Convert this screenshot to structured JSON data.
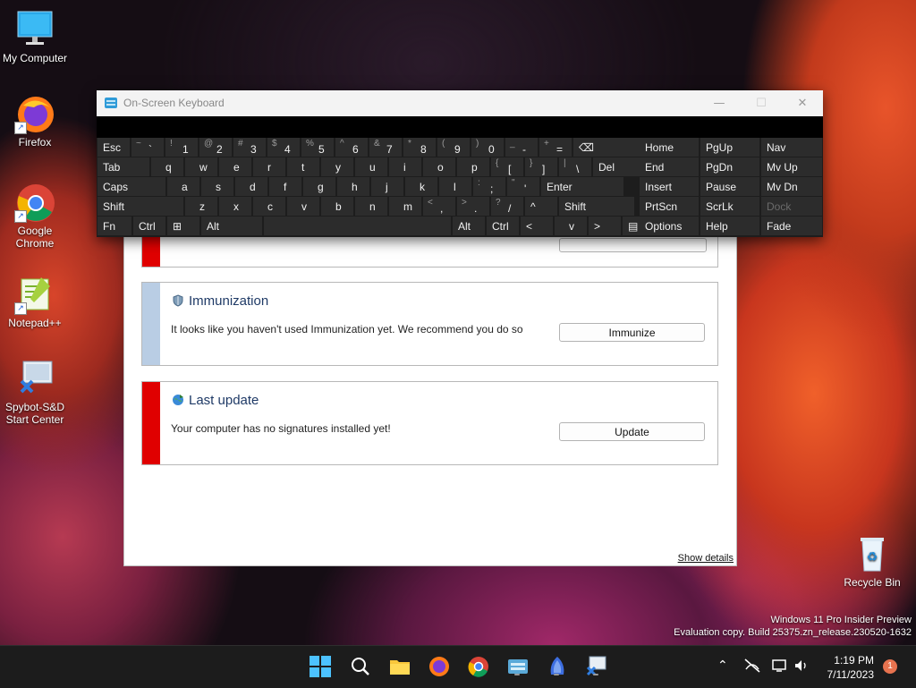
{
  "desktop": {
    "icons": [
      {
        "label": "My Computer"
      },
      {
        "label": "Firefox"
      },
      {
        "label": "Google Chrome"
      },
      {
        "label": "Notepad++"
      },
      {
        "label": "Spybot-S&D Start Center"
      },
      {
        "label": "Recycle Bin"
      }
    ]
  },
  "spybot": {
    "immunization": {
      "title": "Immunization",
      "description": "It looks like you haven't used Immunization yet. We recommend you do so",
      "button": "Immunize",
      "status_color": "#b9cde4"
    },
    "last_update": {
      "title": "Last update",
      "description": "Your computer has no signatures installed yet!",
      "button": "Update",
      "status_color": "#e00000"
    },
    "show_details": "Show details"
  },
  "osk": {
    "title": "On-Screen Keyboard",
    "rows": [
      [
        {
          "label": "Esc"
        },
        {
          "shift": "~",
          "char": "`"
        },
        {
          "shift": "!",
          "char": "1"
        },
        {
          "shift": "@",
          "char": "2"
        },
        {
          "shift": "#",
          "char": "3"
        },
        {
          "shift": "$",
          "char": "4"
        },
        {
          "shift": "%",
          "char": "5"
        },
        {
          "shift": "^",
          "char": "6"
        },
        {
          "shift": "&",
          "char": "7"
        },
        {
          "shift": "*",
          "char": "8"
        },
        {
          "shift": "(",
          "char": "9"
        },
        {
          "shift": ")",
          "char": "0"
        },
        {
          "shift": "_",
          "char": "-"
        },
        {
          "shift": "+",
          "char": "="
        },
        {
          "label": "⌫"
        }
      ],
      [
        {
          "label": "Tab"
        },
        {
          "label": "q"
        },
        {
          "label": "w"
        },
        {
          "label": "e"
        },
        {
          "label": "r"
        },
        {
          "label": "t"
        },
        {
          "label": "y"
        },
        {
          "label": "u"
        },
        {
          "label": "i"
        },
        {
          "label": "o"
        },
        {
          "label": "p"
        },
        {
          "shift": "{",
          "char": "["
        },
        {
          "shift": "}",
          "char": "]"
        },
        {
          "shift": "|",
          "char": "\\"
        },
        {
          "label": "Del"
        }
      ],
      [
        {
          "label": "Caps"
        },
        {
          "label": "a"
        },
        {
          "label": "s"
        },
        {
          "label": "d"
        },
        {
          "label": "f"
        },
        {
          "label": "g"
        },
        {
          "label": "h"
        },
        {
          "label": "j"
        },
        {
          "label": "k"
        },
        {
          "label": "l"
        },
        {
          "shift": ":",
          "char": ";"
        },
        {
          "shift": "\"",
          "char": "'"
        },
        {
          "label": "Enter"
        }
      ],
      [
        {
          "label": "Shift"
        },
        {
          "label": "z"
        },
        {
          "label": "x"
        },
        {
          "label": "c"
        },
        {
          "label": "v"
        },
        {
          "label": "b"
        },
        {
          "label": "n"
        },
        {
          "label": "m"
        },
        {
          "shift": "<",
          "char": ","
        },
        {
          "shift": ">",
          "char": "."
        },
        {
          "shift": "?",
          "char": "/"
        },
        {
          "label": "^"
        },
        {
          "label": "Shift"
        }
      ],
      [
        {
          "label": "Fn"
        },
        {
          "label": "Ctrl"
        },
        {
          "label": "⊞"
        },
        {
          "label": "Alt"
        },
        {
          "label": ""
        },
        {
          "label": "Alt"
        },
        {
          "label": "Ctrl"
        },
        {
          "label": "<"
        },
        {
          "label": "v"
        },
        {
          "label": ">"
        },
        {
          "label": "▤"
        }
      ]
    ],
    "nav_keys": [
      [
        "Home",
        "PgUp",
        "Nav"
      ],
      [
        "End",
        "PgDn",
        "Mv Up"
      ],
      [
        "Insert",
        "Pause",
        "Mv Dn"
      ],
      [
        "PrtScn",
        "ScrLk",
        "Dock"
      ],
      [
        "Options",
        "Help",
        "Fade"
      ]
    ]
  },
  "watermark": {
    "line1": "Windows 11 Pro Insider Preview",
    "line2": "Evaluation copy. Build 25375.zn_release.230520-1632"
  },
  "taskbar": {
    "clock_time": "1:19 PM",
    "clock_date": "7/11/2023",
    "notification_count": "1"
  }
}
